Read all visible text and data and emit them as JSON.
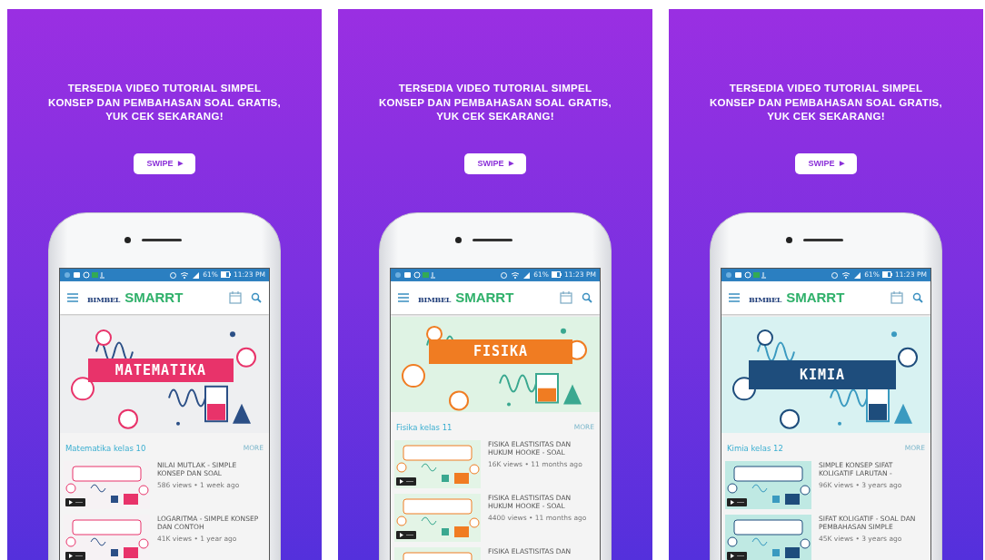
{
  "panels": [
    {
      "headline_lines": [
        "TERSEDIA VIDEO TUTORIAL SIMPEL",
        "KONSEP DAN PEMBAHASAN SOAL GRATIS,",
        "YUK CEK SEKARANG!"
      ],
      "swipe_label": "SWIPE",
      "swipe_arrow": "▶",
      "status": {
        "battery": "61%",
        "time": "11:23 PM"
      },
      "logo": {
        "first": "BIMBEL",
        "second": "SMARRT"
      },
      "banner": {
        "kind": "math",
        "title": "MATEMATIKA"
      },
      "section": {
        "title": "Matematika kelas 10",
        "more": "MORE"
      },
      "videos": [
        {
          "title": "NILAI MUTLAK - SIMPLE KONSEP DAN SOAL",
          "meta": "586 views • 1 week ago"
        },
        {
          "title": "LOGARITMA - SIMPLE KONSEP DAN CONTOH",
          "meta": "41K views • 1 year ago"
        }
      ]
    },
    {
      "headline_lines": [
        "TERSEDIA VIDEO TUTORIAL SIMPEL",
        "KONSEP DAN PEMBAHASAN SOAL GRATIS,",
        "YUK CEK SEKARANG!"
      ],
      "swipe_label": "SWIPE",
      "swipe_arrow": "▶",
      "status": {
        "battery": "61%",
        "time": "11:23 PM"
      },
      "logo": {
        "first": "BIMBEL",
        "second": "SMARRT"
      },
      "banner": {
        "kind": "physics",
        "title": "FISIKA"
      },
      "section": {
        "title": "Fisika kelas 11",
        "more": "MORE"
      },
      "videos": [
        {
          "title": "FISIKA ELASTISITAS DAN HUKUM HOOKE - SOAL",
          "meta": "16K views • 11 months ago"
        },
        {
          "title": "FISIKA ELASTISITAS DAN HUKUM HOOKE - SOAL",
          "meta": "4400 views • 11 months ago"
        },
        {
          "title": "FISIKA ELASTISITAS DAN"
        }
      ]
    },
    {
      "headline_lines": [
        "TERSEDIA VIDEO TUTORIAL SIMPEL",
        "KONSEP DAN PEMBAHASAN SOAL GRATIS,",
        "YUK CEK SEKARANG!"
      ],
      "swipe_label": "SWIPE",
      "swipe_arrow": "▶",
      "status": {
        "battery": "61%",
        "time": "11:23 PM"
      },
      "logo": {
        "first": "BIMBEL",
        "second": "SMARRT"
      },
      "banner": {
        "kind": "chemistry",
        "title": "KIMIA"
      },
      "section": {
        "title": "Kimia kelas 12",
        "more": "MORE"
      },
      "videos": [
        {
          "title": "SIMPLE KONSEP SIFAT KOLIGATIF LARUTAN -",
          "meta": "96K views • 3 years ago"
        },
        {
          "title": "SIFAT KOLIGATIF - SOAL DAN PEMBAHASAN SIMPLE",
          "meta": "45K views • 3 years ago"
        }
      ]
    }
  ]
}
